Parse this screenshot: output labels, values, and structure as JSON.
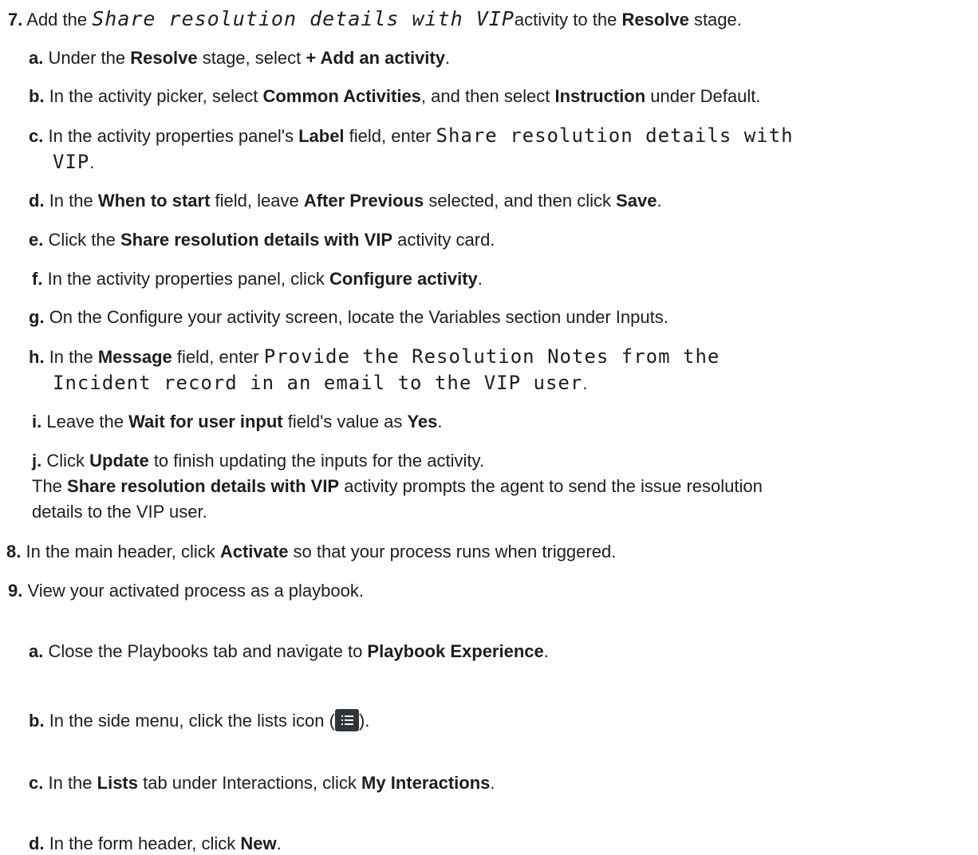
{
  "step7": {
    "num": "7.",
    "pre": "Add the ",
    "activity": "Share resolution details with VIP",
    "mid": "activity to the ",
    "stage": "Resolve",
    "post": " stage.",
    "a": {
      "num": "a.",
      "t1": "Under the ",
      "b1": "Resolve",
      "t2": " stage, select ",
      "b2": "+ Add an activity",
      "t3": "."
    },
    "b": {
      "num": "b.",
      "t1": "In the activity picker, select ",
      "b1": "Common Activities",
      "t2": ", and then select ",
      "b2": "Instruction",
      "t3": " under Default."
    },
    "c": {
      "num": "c.",
      "t1": "In the activity properties panel's ",
      "b1": "Label",
      "t2": " field, enter ",
      "code1": "Share resolution details with",
      "code2": "VIP",
      "t3": "."
    },
    "d": {
      "num": "d.",
      "t1": "In the ",
      "b1": "When to start",
      "t2": " field, leave ",
      "b2": "After Previous",
      "t3": " selected, and then click ",
      "b3": "Save",
      "t4": "."
    },
    "e": {
      "num": "e.",
      "t1": "Click the ",
      "b1": "Share resolution details with VIP",
      "t2": " activity card."
    },
    "f": {
      "num": "f.",
      "t1": "In the activity properties panel, click ",
      "b1": "Configure activity",
      "t2": "."
    },
    "g": {
      "num": "g.",
      "t1": "On the Configure your activity screen, locate the Variables section under Inputs."
    },
    "h": {
      "num": "h.",
      "t1": "In the ",
      "b1": "Message",
      "t2": " field, enter ",
      "code1": "Provide the Resolution Notes from the",
      "code2": "Incident record in an email to the VIP user",
      "t3": "."
    },
    "i": {
      "num": "i.",
      "t1": "Leave the ",
      "b1": "Wait for user input",
      "t2": " field's value as ",
      "b2": "Yes",
      "t3": "."
    },
    "j": {
      "num": "j.",
      "t1": "Click ",
      "b1": "Update",
      "t2": " to finish updating the inputs for the activity."
    },
    "result": {
      "t1": "The ",
      "b1": "Share resolution details with VIP",
      "t2": " activity prompts the agent to send the issue resolution",
      "t3": "details to the VIP user."
    }
  },
  "step8": {
    "num": "8.",
    "t1": "In the main header, click ",
    "b1": "Activate",
    "t2": " so that your process runs when triggered."
  },
  "step9": {
    "num": "9.",
    "t1": "View your activated process as a playbook.",
    "a": {
      "num": "a.",
      "t1": "Close the Playbooks tab and navigate to ",
      "b1": "Playbook Experience",
      "t2": "."
    },
    "b": {
      "num": "b.",
      "t1": "In the side menu, click the lists icon (",
      "icon": "list-icon",
      "t2": ")."
    },
    "c": {
      "num": "c.",
      "t1": "In the ",
      "b1": "Lists",
      "t2": " tab under Interactions, click ",
      "b1b": "My Interactions",
      "t3": "."
    },
    "d": {
      "num": "d.",
      "t1": "In the form header, click ",
      "b1": "New",
      "t2": "."
    }
  },
  "colors": {
    "text": "#1d1d1d",
    "icon_bg": "#2f3539",
    "background": "#ffffff"
  }
}
